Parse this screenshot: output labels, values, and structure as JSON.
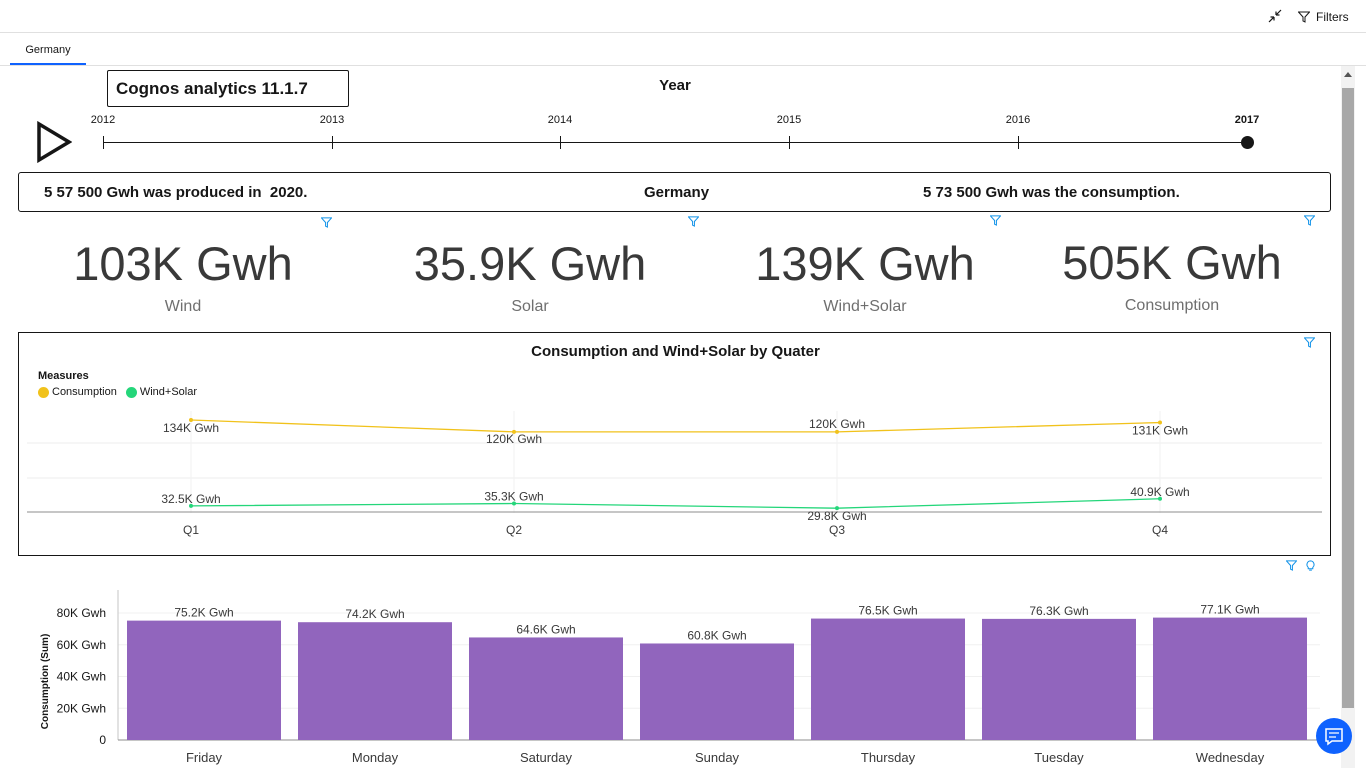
{
  "header": {
    "filters_label": "Filters"
  },
  "tabs": [
    {
      "label": "Germany"
    }
  ],
  "logo_text": "Cognos analytics 11.1.7",
  "timeline": {
    "title": "Year",
    "years": [
      "2012",
      "2013",
      "2014",
      "2015",
      "2016",
      "2017"
    ],
    "selected": "2017"
  },
  "info": {
    "produced": "5 57 500 Gwh was produced in  2020.",
    "country": "Germany",
    "consumption": "5 73 500 Gwh was the consumption."
  },
  "kpis": [
    {
      "value": "103K Gwh",
      "label": "Wind"
    },
    {
      "value": "35.9K Gwh",
      "label": "Solar"
    },
    {
      "value": "139K Gwh",
      "label": "Wind+Solar"
    },
    {
      "value": "505K Gwh",
      "label": "Consumption"
    }
  ],
  "colors": {
    "consumption": "#f1c21b",
    "wind_solar": "#24d67a",
    "bar": "#9165bd",
    "accent": "#0f62fe"
  },
  "line_chart": {
    "title": "Consumption and Wind+Solar by Quater",
    "legend_title": "Measures",
    "legend": [
      "Consumption",
      "Wind+Solar"
    ]
  },
  "chart_data": [
    {
      "type": "line",
      "title": "Consumption and Wind+Solar by Quater",
      "categories": [
        "Q1",
        "Q2",
        "Q3",
        "Q4"
      ],
      "series": [
        {
          "name": "Consumption",
          "values": [
            134,
            120,
            120,
            131
          ],
          "labels": [
            "134K Gwh",
            "120K Gwh",
            "120K Gwh",
            "131K Gwh"
          ]
        },
        {
          "name": "Wind+Solar",
          "values": [
            32.5,
            35.3,
            29.8,
            40.9
          ],
          "labels": [
            "32.5K Gwh",
            "35.3K Gwh",
            "29.8K Gwh",
            "40.9K Gwh"
          ]
        }
      ],
      "legend": "top-left",
      "grid": true
    },
    {
      "type": "bar",
      "categories": [
        "Friday",
        "Monday",
        "Saturday",
        "Sunday",
        "Thursday",
        "Tuesday",
        "Wednesday"
      ],
      "values": [
        75.2,
        74.2,
        64.6,
        60.8,
        76.5,
        76.3,
        77.1
      ],
      "labels": [
        "75.2K Gwh",
        "74.2K Gwh",
        "64.6K Gwh",
        "60.8K Gwh",
        "76.5K Gwh",
        "76.3K Gwh",
        "77.1K Gwh"
      ],
      "ylabel": "Consumption (Sum)",
      "yticks": [
        "0",
        "20K Gwh",
        "40K Gwh",
        "60K Gwh",
        "80K Gwh"
      ],
      "ylim": [
        0,
        80
      ],
      "grid": true
    }
  ]
}
